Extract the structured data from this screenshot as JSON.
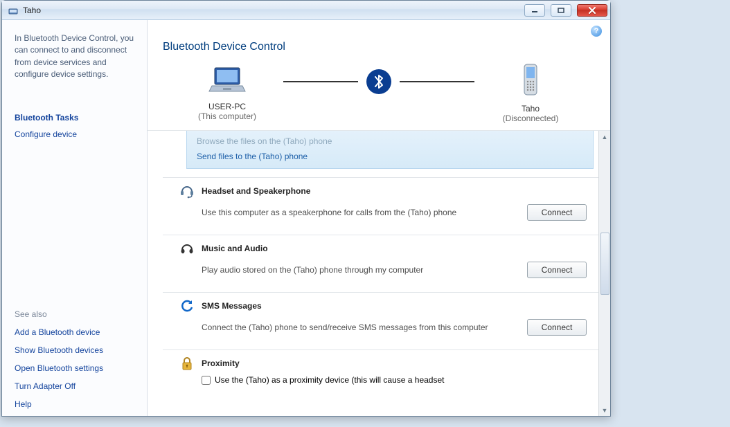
{
  "window": {
    "title": "Taho"
  },
  "sidebar": {
    "intro": "In Bluetooth Device Control, you can connect to and disconnect from device services and configure device settings.",
    "tasks_header": "Bluetooth Tasks",
    "tasks": [
      {
        "label": "Configure device"
      }
    ],
    "see_also_header": "See also",
    "see_also": [
      {
        "label": "Add a Bluetooth device"
      },
      {
        "label": "Show Bluetooth devices"
      },
      {
        "label": "Open Bluetooth settings"
      },
      {
        "label": "Turn Adapter Off"
      },
      {
        "label": "Help"
      }
    ]
  },
  "page": {
    "title": "Bluetooth Device Control",
    "computer": {
      "name": "USER-PC",
      "sub": "(This computer)"
    },
    "device": {
      "name": "Taho",
      "sub": "(Disconnected)"
    }
  },
  "file_panel": {
    "browse": "Browse the files on the (Taho) phone",
    "send": "Send files to the (Taho) phone"
  },
  "services": {
    "headset": {
      "title": "Headset and Speakerphone",
      "desc": "Use this computer as a speakerphone for calls from the (Taho) phone",
      "button": "Connect"
    },
    "music": {
      "title": "Music and Audio",
      "desc": "Play audio stored on the (Taho) phone through my computer",
      "button": "Connect"
    },
    "sms": {
      "title": "SMS Messages",
      "desc": "Connect the (Taho) phone to send/receive SMS messages from this computer",
      "button": "Connect"
    },
    "proximity": {
      "title": "Proximity",
      "checkbox_label": "Use the (Taho) as a proximity device (this will cause a headset"
    }
  }
}
